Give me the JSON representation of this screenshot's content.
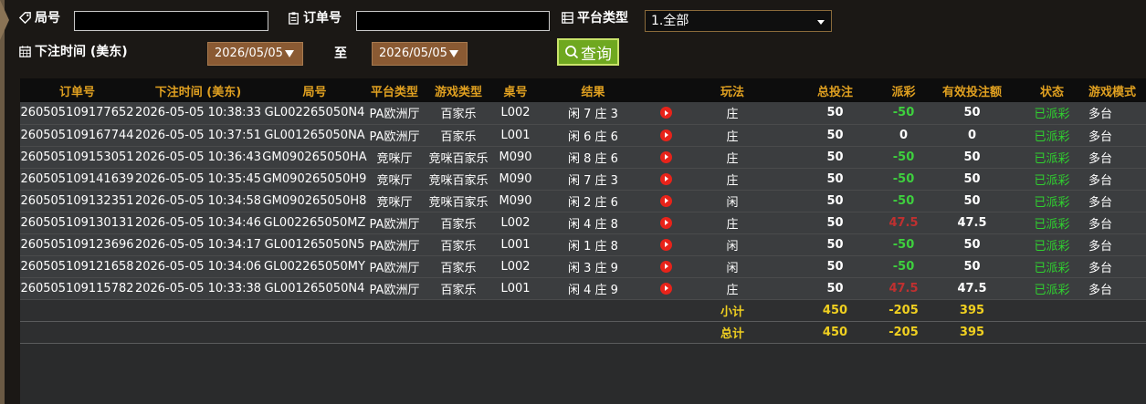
{
  "filters": {
    "round_label": "局号",
    "order_label": "订单号",
    "platform_label": "平台类型",
    "platform_selected": "1.全部",
    "bet_time_label": "下注时间 (美东)",
    "date_from": "2026/05/05",
    "to_label": "至",
    "date_to": "2026/05/05",
    "query_button": "查询"
  },
  "table": {
    "headers": [
      "订单号",
      "下注时间 (美东)",
      "局号",
      "平台类型",
      "游戏类型",
      "桌号",
      "结果",
      "",
      "玩法",
      "总投注",
      "派彩",
      "有效投注额",
      "状态",
      "游戏模式"
    ],
    "rows": [
      {
        "order": "260505109177652",
        "time": "2026-05-05 10:38:33",
        "round": "GL002265050N4",
        "platform": "PA欧洲厅",
        "game": "百家乐",
        "table": "L002",
        "result": "闲 7 庄 3",
        "play": "庄",
        "bet": "50",
        "payout": "-50",
        "payout_color": "green",
        "valid": "50",
        "status": "已派彩",
        "mode": "多台"
      },
      {
        "order": "260505109167744",
        "time": "2026-05-05 10:37:51",
        "round": "GL001265050NA",
        "platform": "PA欧洲厅",
        "game": "百家乐",
        "table": "L001",
        "result": "闲 6 庄 6",
        "play": "庄",
        "bet": "50",
        "payout": "0",
        "payout_color": "white",
        "valid": "0",
        "status": "已派彩",
        "mode": "多台"
      },
      {
        "order": "260505109153051",
        "time": "2026-05-05 10:36:43",
        "round": "GM090265050HA",
        "platform": "竞咪厅",
        "game": "竞咪百家乐",
        "table": "M090",
        "result": "闲 8 庄 6",
        "play": "庄",
        "bet": "50",
        "payout": "-50",
        "payout_color": "green",
        "valid": "50",
        "status": "已派彩",
        "mode": "多台"
      },
      {
        "order": "260505109141639",
        "time": "2026-05-05 10:35:45",
        "round": "GM090265050H9",
        "platform": "竞咪厅",
        "game": "竞咪百家乐",
        "table": "M090",
        "result": "闲 7 庄 3",
        "play": "庄",
        "bet": "50",
        "payout": "-50",
        "payout_color": "green",
        "valid": "50",
        "status": "已派彩",
        "mode": "多台"
      },
      {
        "order": "260505109132351",
        "time": "2026-05-05 10:34:58",
        "round": "GM090265050H8",
        "platform": "竞咪厅",
        "game": "竞咪百家乐",
        "table": "M090",
        "result": "闲 2 庄 6",
        "play": "闲",
        "bet": "50",
        "payout": "-50",
        "payout_color": "green",
        "valid": "50",
        "status": "已派彩",
        "mode": "多台"
      },
      {
        "order": "260505109130131",
        "time": "2026-05-05 10:34:46",
        "round": "GL002265050MZ",
        "platform": "PA欧洲厅",
        "game": "百家乐",
        "table": "L002",
        "result": "闲 4 庄 8",
        "play": "庄",
        "bet": "50",
        "payout": "47.5",
        "payout_color": "red",
        "valid": "47.5",
        "status": "已派彩",
        "mode": "多台"
      },
      {
        "order": "260505109123696",
        "time": "2026-05-05 10:34:17",
        "round": "GL001265050N5",
        "platform": "PA欧洲厅",
        "game": "百家乐",
        "table": "L001",
        "result": "闲 1 庄 8",
        "play": "闲",
        "bet": "50",
        "payout": "-50",
        "payout_color": "green",
        "valid": "50",
        "status": "已派彩",
        "mode": "多台"
      },
      {
        "order": "260505109121658",
        "time": "2026-05-05 10:34:06",
        "round": "GL002265050MY",
        "platform": "PA欧洲厅",
        "game": "百家乐",
        "table": "L002",
        "result": "闲 3 庄 9",
        "play": "闲",
        "bet": "50",
        "payout": "-50",
        "payout_color": "green",
        "valid": "50",
        "status": "已派彩",
        "mode": "多台"
      },
      {
        "order": "260505109115782",
        "time": "2026-05-05 10:33:38",
        "round": "GL001265050N4",
        "platform": "PA欧洲厅",
        "game": "百家乐",
        "table": "L001",
        "result": "闲 4 庄 9",
        "play": "庄",
        "bet": "50",
        "payout": "47.5",
        "payout_color": "red",
        "valid": "47.5",
        "status": "已派彩",
        "mode": "多台"
      }
    ],
    "subtotal": {
      "label": "小计",
      "bet": "450",
      "payout": "-205",
      "valid": "395"
    },
    "total": {
      "label": "总计",
      "bet": "450",
      "payout": "-205",
      "valid": "395"
    }
  },
  "colors": {
    "header_text": "#e0a020",
    "row_bg": "#3b3d3f",
    "status_green": "#2fd12f",
    "payout_negative": "#3ed03e",
    "payout_positive": "#c03030",
    "summary_text": "#f0d020",
    "query_button": "#6fa820",
    "date_picker": "#8a5a33"
  }
}
